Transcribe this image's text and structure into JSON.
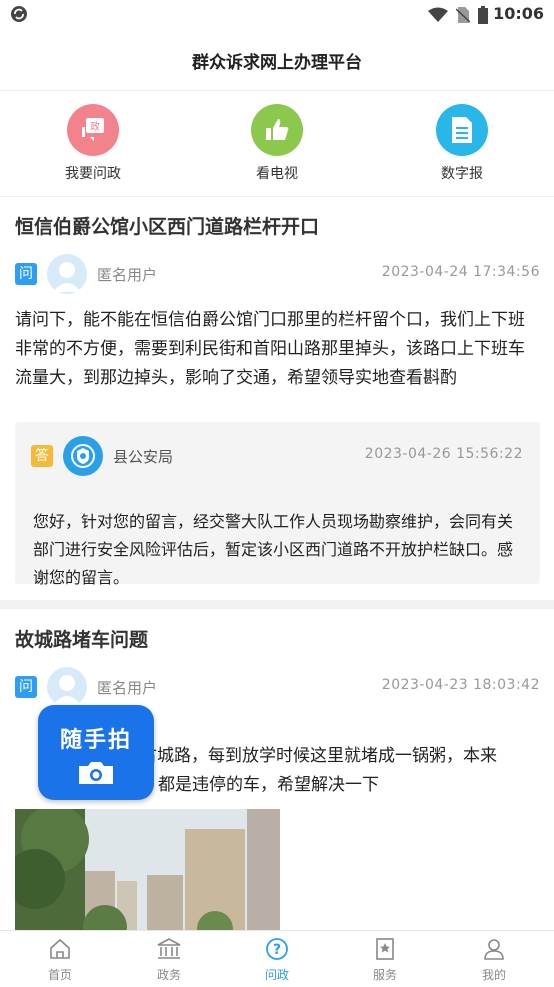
{
  "status_bar": {
    "time": "10:06"
  },
  "app": {
    "title": "群众诉求网上办理平台"
  },
  "quick_links": [
    {
      "label": "我要问政",
      "icon": "politics-chat-icon",
      "color": "#f2838c"
    },
    {
      "label": "看电视",
      "icon": "thumbs-up-icon",
      "color": "#8cc84b"
    },
    {
      "label": "数字报",
      "icon": "document-icon",
      "color": "#29b6e8"
    }
  ],
  "posts": [
    {
      "title": "恒信伯爵公馆小区西门道路栏杆开口",
      "question": {
        "tag": "问",
        "user": "匿名用户",
        "date": "2023-04-24  17:34:56",
        "text": "请问下，能不能在恒信伯爵公馆门口那里的栏杆留个口，我们上下班非常的不方便，需要到利民街和首阳山路那里掉头，该路口上下班车流量大，到那边掉头，影响了交通，希望领导实地查看斟酌"
      },
      "answer": {
        "tag": "答",
        "user": "县公安局",
        "date": "2023-04-26  15:56:22",
        "text": "您好，针对您的留言，经交警大队工作人员现场勘察维护，会同有关部门进行安全风险评估后，暂定该小区西门道路不开放护栏缺口。感谢您的留言。"
      }
    },
    {
      "title": "故城路堵车问题",
      "question": {
        "tag": "问",
        "user": "匿名用户",
        "date": "2023-04-23  18:03:42",
        "text_line1": "古城路，每到放学时候这里就堵成一锅粥，本来",
        "text_line2": "都是违停的车，希望解决一下"
      }
    }
  ],
  "float_button": {
    "label": "随手拍",
    "icon": "camera-icon"
  },
  "tabs": [
    {
      "label": "首页",
      "icon": "home-icon",
      "active": false
    },
    {
      "label": "政务",
      "icon": "government-icon",
      "active": false
    },
    {
      "label": "问政",
      "icon": "question-icon",
      "active": true
    },
    {
      "label": "服务",
      "icon": "star-bookmark-icon",
      "active": false
    },
    {
      "label": "我的",
      "icon": "person-icon",
      "active": false
    }
  ],
  "colors": {
    "accent": "#2f9df2",
    "float_button": "#1a73e8",
    "question_tag": "#2f9df2",
    "answer_tag": "#f5b93a"
  }
}
